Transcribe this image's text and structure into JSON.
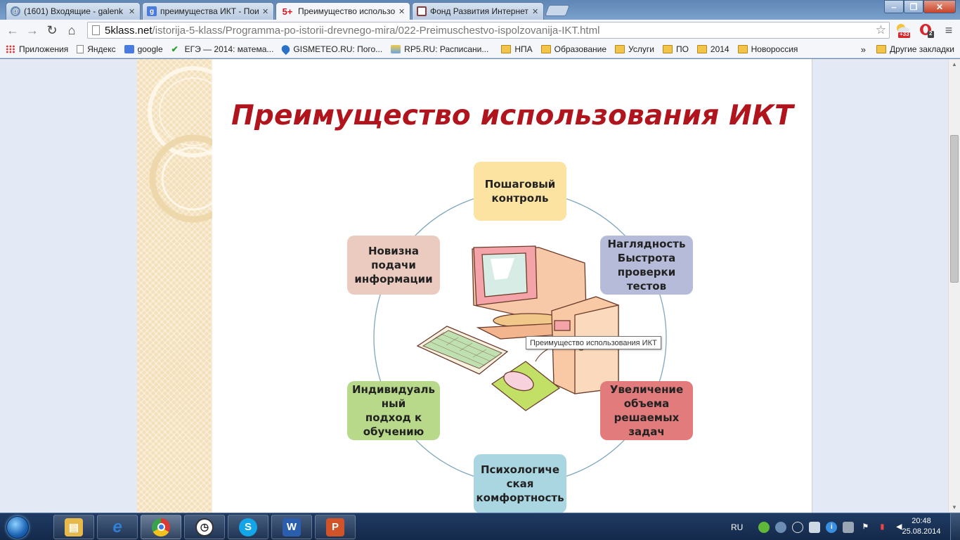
{
  "tabs": [
    {
      "label": "(1601) Входящие - galenk",
      "favicon": "mail-icon",
      "active": false
    },
    {
      "label": "преимущества ИКТ - Пои",
      "favicon": "google-icon",
      "active": false
    },
    {
      "label": "Преимущество использо",
      "favicon": "5plus-icon",
      "active": true
    },
    {
      "label": "Фонд Развития Интернет",
      "favicon": "site-icon",
      "active": false
    }
  ],
  "favicon_text": {
    "five_plus": "5+",
    "google": "g"
  },
  "omnibox": {
    "host": "5klass.net",
    "path": "/istorija-5-klass/Programma-po-istorii-drevnego-mira/022-Preimuschestvo-ispolzovanija-IKT.html"
  },
  "extensions": {
    "weather_badge": "+33",
    "opera_badge": "2"
  },
  "bookmarks": {
    "apps": "Приложения",
    "items": [
      {
        "label": "Яндекс",
        "icon": "page-icon"
      },
      {
        "label": "google",
        "icon": "google-icon"
      },
      {
        "label": "ЕГЭ — 2014: матема...",
        "icon": "check-icon"
      },
      {
        "label": "GISMETEO.RU: Пого...",
        "icon": "weather-drop-icon"
      },
      {
        "label": "RP5.RU: Расписани...",
        "icon": "rp5-icon"
      },
      {
        "label": "НПА",
        "icon": "folder-icon"
      },
      {
        "label": "Образование",
        "icon": "folder-icon"
      },
      {
        "label": "Услуги",
        "icon": "folder-icon"
      },
      {
        "label": "ПО",
        "icon": "folder-icon"
      },
      {
        "label": "2014",
        "icon": "folder-icon"
      },
      {
        "label": "Новороссия",
        "icon": "folder-icon"
      }
    ],
    "more": "»",
    "other": "Другие закладки"
  },
  "slide": {
    "title": "Преимущество использования ИКТ",
    "nodes": [
      {
        "id": "top",
        "text": "Пошаговый\nконтроль",
        "color": "#fde3a2"
      },
      {
        "id": "top-right",
        "text": "Наглядность\nБыстрота\nпроверки\nтестов",
        "color": "#b5bbd8"
      },
      {
        "id": "bottom-right",
        "text": "Увеличение\nобъема\nрешаемых\nзадач",
        "color": "#e27b7b"
      },
      {
        "id": "bottom",
        "text": "Психологиче\nская\nкомфортность",
        "color": "#a9d6e0"
      },
      {
        "id": "bottom-left",
        "text": "Индивидуаль\nный\nподход к\nобучению",
        "color": "#b8d98a"
      },
      {
        "id": "top-left",
        "text": "Новизна\nподачи\nинформации",
        "color": "#ebcbc0"
      }
    ],
    "tooltip": "Преимущество использования ИКТ"
  },
  "taskbar": {
    "apps": [
      {
        "name": "explorer-icon",
        "color": "#e8b84a"
      },
      {
        "name": "ie-icon",
        "color": "#2f7fd6"
      },
      {
        "name": "chrome-icon",
        "color": "#3aa24a"
      },
      {
        "name": "clock-app-icon",
        "color": "#ffffff"
      },
      {
        "name": "skype-icon",
        "color": "#12a5e8"
      },
      {
        "name": "word-icon",
        "color": "#2b5fae"
      },
      {
        "name": "powerpoint-icon",
        "color": "#d0532a"
      }
    ],
    "lang": "RU",
    "time": "20:48",
    "date": "25.08.2014"
  }
}
